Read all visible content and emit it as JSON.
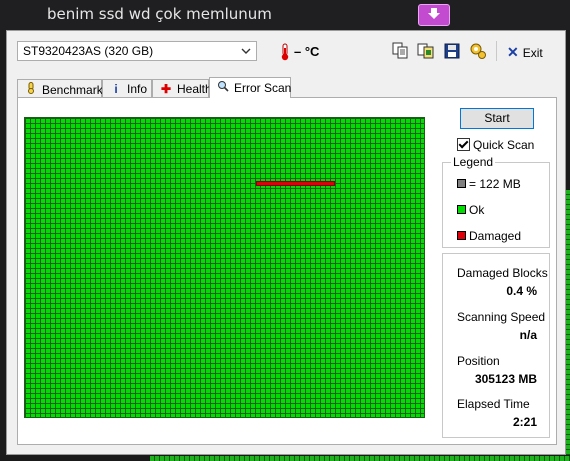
{
  "chat": {
    "message": "benim ssd wd çok memlunum"
  },
  "app": {
    "drive": "ST9320423AS (320 GB)",
    "temperature": "– °C",
    "exit_label": "Exit",
    "tabs": [
      {
        "label": "Benchmark",
        "icon": "thermometer-icon"
      },
      {
        "label": "Info",
        "icon": "info-icon"
      },
      {
        "label": "Health",
        "icon": "health-cross-icon"
      },
      {
        "label": "Error Scan",
        "icon": "magnifier-icon"
      }
    ],
    "active_tab": "Error Scan",
    "toolbar_icons": [
      "copy-icon",
      "copy-all-icon",
      "save-icon",
      "options-icon"
    ]
  },
  "error_scan": {
    "start_label": "Start",
    "quick_scan_label": "Quick Scan",
    "quick_scan_checked": true,
    "legend": {
      "title": "Legend",
      "items": [
        {
          "label": "= 122 MB",
          "color": "#808080"
        },
        {
          "label": "Ok",
          "color": "#00dd00"
        },
        {
          "label": "Damaged",
          "color": "#e0000a"
        }
      ]
    },
    "stats": {
      "damaged_blocks_label": "Damaged Blocks",
      "damaged_blocks_value": "0.4 %",
      "scanning_speed_label": "Scanning Speed",
      "scanning_speed_value": "n/a",
      "position_label": "Position",
      "position_value": "305123 MB",
      "elapsed_time_label": "Elapsed Time",
      "elapsed_time_value": "2:21"
    },
    "colors": {
      "ok": "#00dd00",
      "damaged": "#e0000a",
      "grid_line": "#1a5e1a"
    }
  }
}
